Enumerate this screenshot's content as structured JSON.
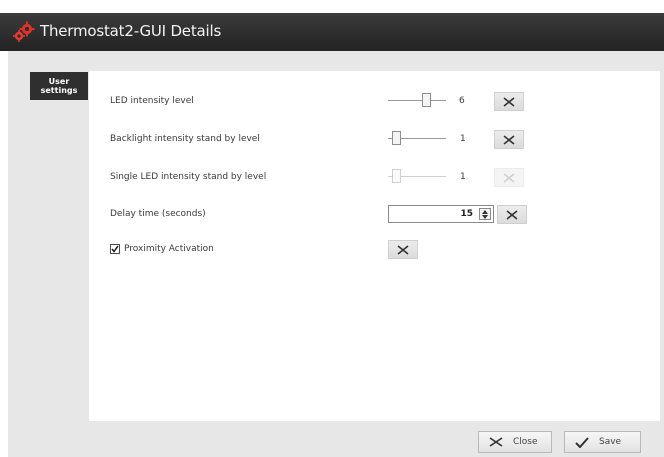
{
  "window": {
    "title": "Thermostat2-GUI Details",
    "icon": "gears-icon"
  },
  "sidebar": {
    "tab_line1": "User",
    "tab_line2": "settings"
  },
  "settings": {
    "led_intensity": {
      "label": "LED intensity level",
      "value": "6",
      "slider_fraction": 0.67
    },
    "backlight": {
      "label": "Backlight intensity stand by level",
      "value": "1",
      "slider_fraction": 0.1
    },
    "single_led": {
      "label": "Single LED intensity stand by level",
      "value": "1",
      "slider_fraction": 0.1,
      "disabled": true
    },
    "delay": {
      "label": "Delay time (seconds)",
      "value": "15"
    },
    "proximity": {
      "label": "Proximity Activation",
      "checked": true
    }
  },
  "footer": {
    "close_label": "Close",
    "save_label": "Save"
  },
  "colors": {
    "title_bar": "#2b2b2b",
    "frame": "#e7e7e7",
    "accent": "#d8322b"
  }
}
